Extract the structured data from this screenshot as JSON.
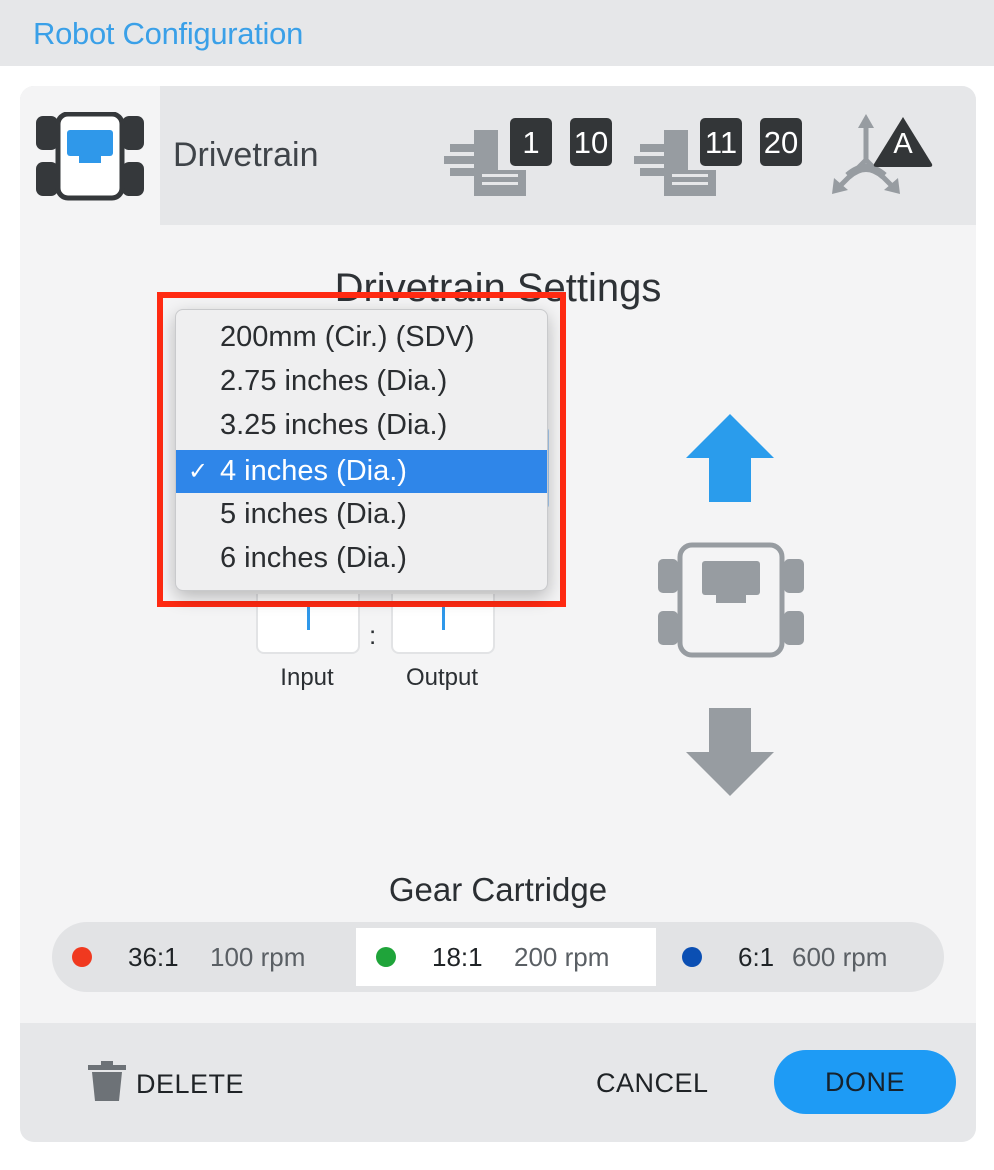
{
  "app": {
    "title": "Robot Configuration"
  },
  "header": {
    "device_label": "Drivetrain",
    "ports_left": [
      "1",
      "10"
    ],
    "ports_right": [
      "11",
      "20"
    ],
    "gyro_label": "A"
  },
  "settings": {
    "title": "Drivetrain Settings",
    "gear_ratio": {
      "input_label": "Input",
      "output_label": "Output",
      "separator": ":"
    }
  },
  "wheel_dropdown": {
    "options": [
      {
        "label": "200mm (Cir.) (SDV)",
        "selected": false
      },
      {
        "label": "2.75 inches (Dia.)",
        "selected": false
      },
      {
        "label": "3.25 inches (Dia.)",
        "selected": false
      },
      {
        "label": "4 inches (Dia.)",
        "selected": true
      },
      {
        "label": "5 inches (Dia.)",
        "selected": false
      },
      {
        "label": "6 inches (Dia.)",
        "selected": false
      }
    ],
    "check_glyph": "✓"
  },
  "gear_cartridge": {
    "title": "Gear Cartridge",
    "options": [
      {
        "ratio": "36:1",
        "rpm": "100 rpm",
        "color": "#f0391f",
        "selected": false
      },
      {
        "ratio": "18:1",
        "rpm": "200 rpm",
        "color": "#1fa43a",
        "selected": true
      },
      {
        "ratio": "6:1",
        "rpm": "600 rpm",
        "color": "#0b4fb3",
        "selected": false
      }
    ]
  },
  "footer": {
    "delete_label": "DELETE",
    "cancel_label": "CANCEL",
    "done_label": "DONE"
  },
  "colors": {
    "accent": "#1e9bf5",
    "title_blue": "#3aa0e8",
    "highlight": "#ff2a12",
    "icon_gray": "#979ca1"
  }
}
